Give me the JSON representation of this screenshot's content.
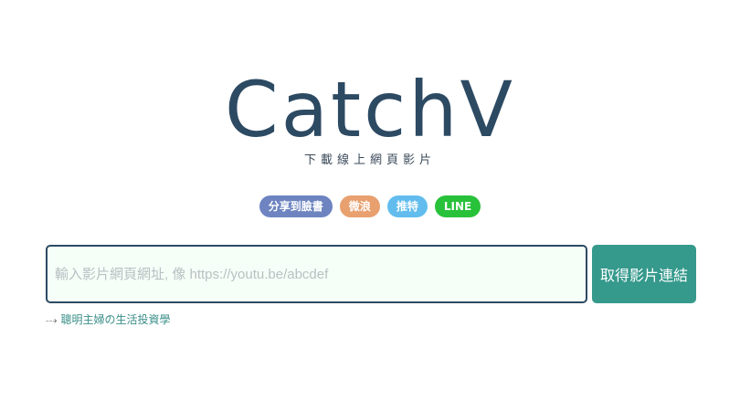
{
  "brand": {
    "logo_text": "CatchV",
    "tagline": "下載線上網頁影片"
  },
  "share": [
    {
      "id": "facebook",
      "label": "分享到臉書",
      "color": "#6d84c0"
    },
    {
      "id": "weibo",
      "label": "微浪",
      "color": "#e8a06f"
    },
    {
      "id": "twitter",
      "label": "推特",
      "color": "#62bdee"
    },
    {
      "id": "line",
      "label": "LINE",
      "color": "#28c13a"
    }
  ],
  "form": {
    "input_placeholder": "輸入影片網頁網址, 像 https://youtu.be/abcdef",
    "input_value": "",
    "submit_label": "取得影片連結"
  },
  "promo": {
    "arrow": "⤏",
    "link_text": "聰明主婦の生活投資學"
  }
}
